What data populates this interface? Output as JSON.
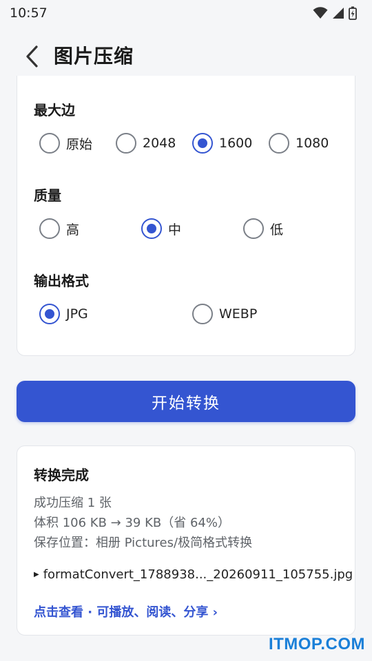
{
  "status_bar": {
    "time": "10:57",
    "icons": [
      "wifi-icon",
      "signal-icon",
      "battery-icon"
    ]
  },
  "app_bar": {
    "title": "图片压缩",
    "back_icon": "chevron-left-icon"
  },
  "settings": {
    "max_edge": {
      "label": "最大边",
      "options": [
        "原始",
        "2048",
        "1600",
        "1080"
      ],
      "selected": "1600"
    },
    "quality": {
      "label": "质量",
      "options": [
        "高",
        "中",
        "低"
      ],
      "selected": "中"
    },
    "format": {
      "label": "输出格式",
      "options": [
        "JPG",
        "WEBP"
      ],
      "selected": "JPG"
    }
  },
  "convert_button": {
    "label": "开始转换"
  },
  "result": {
    "title": "转换完成",
    "summary": "成功压缩 1 张",
    "size": "体积 106 KB → 39 KB（省 64%）",
    "location": "保存位置：相册 Pictures/极简格式转换",
    "file_name": "formatConvert_1788938..._20260911_105755.jpg",
    "link": "点击查看 · 可播放、阅读、分享 ›"
  },
  "watermark": "ITMOP.COM",
  "colors": {
    "accent": "#3455d1",
    "background": "#f5f6f8",
    "card": "#ffffff",
    "watermark": "#1a7fd8"
  }
}
